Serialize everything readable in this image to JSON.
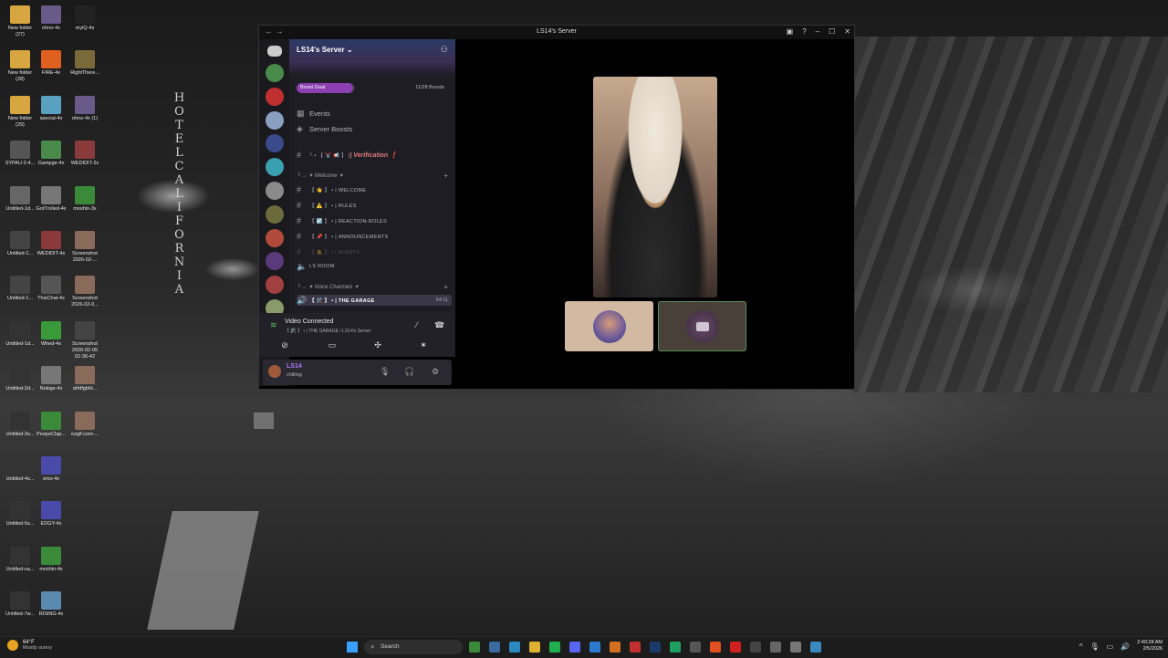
{
  "desktop": {
    "sign_text": "HOTEL CALIFORNIA",
    "columns": [
      [
        {
          "label": "New folder\n(27)",
          "color": "#d8a640"
        },
        {
          "label": "New folder\n(28)",
          "color": "#d8a640"
        },
        {
          "label": "New folder\n(29)",
          "color": "#d8a640"
        },
        {
          "label": "SYPAU-2-4...",
          "color": "#555"
        },
        {
          "label": "Untitled-1d...",
          "color": "#666"
        },
        {
          "label": "Untitled-1...",
          "color": "#444"
        },
        {
          "label": "Untitled-1...",
          "color": "#444"
        },
        {
          "label": "Untitled-1d...",
          "color": "#333"
        },
        {
          "label": "Untitled-2d...",
          "color": "#333"
        },
        {
          "label": "Untitled-3s...",
          "color": "#333"
        },
        {
          "label": "Untitled-4s...",
          "color": "#333"
        },
        {
          "label": "Untitled-5s...",
          "color": "#333"
        },
        {
          "label": "Untitled-sa...",
          "color": "#333"
        },
        {
          "label": "Untitled-7w...",
          "color": "#333"
        }
      ],
      [
        {
          "label": "ohno-4x",
          "color": "#6a5a8a"
        },
        {
          "label": "FIRE-4x",
          "color": "#e06020"
        },
        {
          "label": "special-4x",
          "color": "#5aa0c0"
        },
        {
          "label": "Gampge-4x",
          "color": "#4a8a4a"
        },
        {
          "label": "GotTrolled-4x",
          "color": "#777"
        },
        {
          "label": "WEDIDIT-4x",
          "color": "#8a3a3a"
        },
        {
          "label": "ThisChat-4x",
          "color": "#555"
        },
        {
          "label": "Whed-4x",
          "color": "#3a9a3a"
        },
        {
          "label": "Nokige-4x",
          "color": "#777"
        },
        {
          "label": "PeepoClap...",
          "color": "#3a8a3a"
        },
        {
          "label": "emo-4x",
          "color": "#4a4aaa"
        },
        {
          "label": "EDGY-4x",
          "color": "#4a4aaa"
        },
        {
          "label": "moshin-4x",
          "color": "#3a8a3a"
        },
        {
          "label": "RISING-4x",
          "color": "#5a8ab0"
        }
      ],
      [
        {
          "label": "mylQ-4x",
          "color": "#222"
        },
        {
          "label": "RightThere...",
          "color": "#7a6a3a"
        },
        {
          "label": "ohno-4x (1)",
          "color": "#6a5a8a"
        },
        {
          "label": "WEDIDIT-2x",
          "color": "#8a3a3a"
        },
        {
          "label": "moshin-3x",
          "color": "#3a8a3a"
        },
        {
          "label": "Screenshot\n2026-02-...",
          "color": "#8a6a5a"
        },
        {
          "label": "Screenshot\n2026-02-0...",
          "color": "#8a6a5a"
        },
        {
          "label": "Screenshot\n2026-02-05\n02-36-42",
          "color": "#444"
        },
        {
          "label": "drfdfgbfd...",
          "color": "#8a6a5a"
        },
        {
          "label": "ezgif.com-...",
          "color": "#8a6a5a"
        }
      ]
    ]
  },
  "window": {
    "title": "LS14's Server",
    "server_name": "LS14's Server",
    "boost_goal": "Boost Goal",
    "boost_count": "11/28 Boosts",
    "events": "Events",
    "server_boosts": "Server Boosts",
    "verification_prefix": "╰ • 【 ✂️ 📢 】 |",
    "verification_label": "| Verification ❗",
    "welcome_category": "╰ → ✦ Welcome ✦",
    "channels": [
      {
        "icon": "#",
        "label": "【 👋 】 • | WELCOME"
      },
      {
        "icon": "#",
        "label": "【 ⚠️ 】 • | RULES"
      },
      {
        "icon": "#",
        "label": "【 ☑️ 】 • | REACTION-ROLES"
      },
      {
        "icon": "#",
        "label": "【 📌 】 • | ANNOUNCEMENTS"
      },
      {
        "icon": "#",
        "label": "【 🔔 】 • | ALERTS"
      }
    ],
    "ls_room": "LS ROOM",
    "voice_category": "╰ → ✦ Voice Channels ✦",
    "voice_channel": "【 🛠️ 】 • | THE GARAGE",
    "voice_time": "54:11",
    "voice_connected": "Video Connected",
    "voice_connected_sub": "【 🛠️ 】 • | THE GARAGE / LS14's Server",
    "user_name": "LS14",
    "user_status": "chilling"
  },
  "taskbar": {
    "temp": "64°F",
    "weather": "Mostly sunny",
    "search_placeholder": "Search",
    "time": "2:40:28 AM",
    "date": "2/5/2026"
  },
  "colors": {
    "accent": "#8c3fb0",
    "active_border": "#5a8f5a"
  }
}
